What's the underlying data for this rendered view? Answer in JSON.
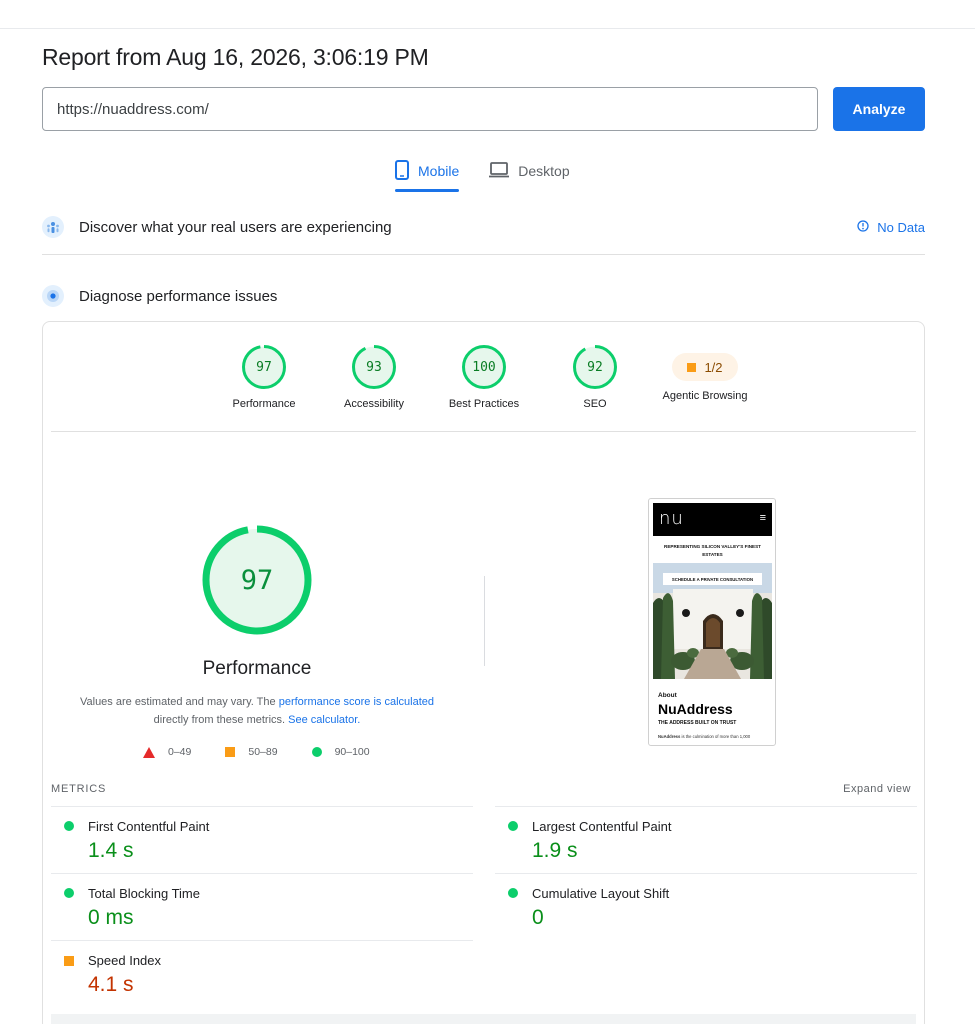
{
  "report": {
    "title": "Report from Aug 16, 2026, 3:06:19 PM"
  },
  "search": {
    "url": "https://nuaddress.com/",
    "analyze_label": "Analyze"
  },
  "tabs": {
    "mobile": "Mobile",
    "desktop": "Desktop",
    "active": "mobile"
  },
  "field_data": {
    "heading": "Discover what your real users are experiencing",
    "status": "No Data"
  },
  "diagnose": {
    "heading": "Diagnose performance issues"
  },
  "categories": [
    {
      "label": "Performance",
      "score": "97"
    },
    {
      "label": "Accessibility",
      "score": "93"
    },
    {
      "label": "Best Practices",
      "score": "100"
    },
    {
      "label": "SEO",
      "score": "92"
    },
    {
      "label": "Agentic Browsing",
      "score": "1/2"
    }
  ],
  "performance": {
    "score": "97",
    "title": "Performance",
    "note_prefix": "Values are estimated and may vary. The ",
    "note_link1": "performance score is calculated",
    "note_mid": "directly from these metrics. ",
    "note_link2": "See calculator.",
    "legend": [
      "0–49",
      "50–89",
      "90–100"
    ]
  },
  "screenshot": {
    "logo": "nu",
    "menu": "≡",
    "tagline": "REPRESENTING SILICON VALLEY'S FINEST ESTATES",
    "cta": "SCHEDULE A PRIVATE CONSULTATION",
    "about": "About",
    "name": "NuAddress",
    "subtitle": "THE ADDRESS BUILT ON TRUST",
    "body_bold": "NuAddress",
    "body": " is the culmination of more than 1,000"
  },
  "metrics": {
    "heading": "METRICS",
    "expand": "Expand view",
    "items": [
      {
        "name": "First Contentful Paint",
        "value": "1.4 s",
        "rating": "good"
      },
      {
        "name": "Largest Contentful Paint",
        "value": "1.9 s",
        "rating": "good"
      },
      {
        "name": "Total Blocking Time",
        "value": "0 ms",
        "rating": "good"
      },
      {
        "name": "Cumulative Layout Shift",
        "value": "0",
        "rating": "good"
      },
      {
        "name": "Speed Index",
        "value": "4.1 s",
        "rating": "average"
      }
    ]
  },
  "colors": {
    "accent": "#1a73e8",
    "pass": "#0cce6b",
    "average": "#fa9c16",
    "fail": "#e52a2a"
  }
}
